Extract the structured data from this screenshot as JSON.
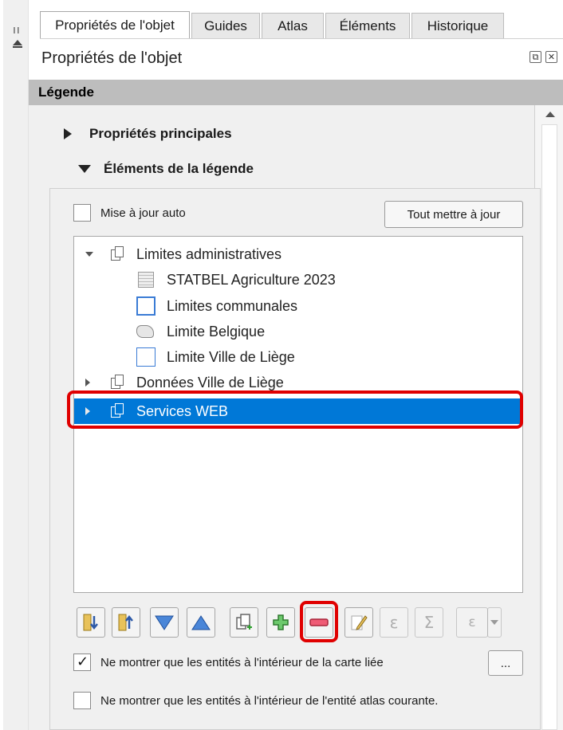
{
  "tabs": [
    {
      "label": "Propriétés de l'objet",
      "active": true
    },
    {
      "label": "Guides",
      "active": false
    },
    {
      "label": "Atlas",
      "active": false
    },
    {
      "label": "Éléments",
      "active": false
    },
    {
      "label": "Historique",
      "active": false
    }
  ],
  "panel_title": "Propriétés de l'objet",
  "section_title": "Légende",
  "collapsibles": {
    "main_properties": "Propriétés principales",
    "legend_items": "Éléments de la légende"
  },
  "auto_update": {
    "label": "Mise à jour auto",
    "checked": false
  },
  "update_all_button": "Tout mettre à jour",
  "tree": {
    "group_1": "Limites administratives",
    "layer_1": "STATBEL Agriculture 2023",
    "layer_2": "Limites communales",
    "layer_3": "Limite Belgique",
    "layer_4": "Limite Ville de Liège",
    "group_2": "Données Ville de Liège",
    "group_3": "Services WEB"
  },
  "toolbar": {
    "icons": [
      "move-down-icon",
      "move-up-icon",
      "arrow-down-icon",
      "arrow-up-icon",
      "add-group-icon",
      "add-item-icon",
      "remove-item-icon",
      "edit-item-icon",
      "expression-icon",
      "sum-icon",
      "expression-filter-icon",
      "dropdown-icon"
    ],
    "expression_glyph": "ε",
    "sum_glyph": "Σ"
  },
  "filter_map": {
    "label": "Ne montrer que les entités à l'intérieur de la carte liée",
    "checked": true,
    "button": "..."
  },
  "filter_atlas": {
    "label": "Ne montrer que les entités à l'intérieur de l'entité atlas courante.",
    "checked": false
  },
  "colors": {
    "selection": "#0078d7",
    "highlight": "#e00000",
    "add": "#2e9e2e",
    "remove": "#d9344f"
  }
}
